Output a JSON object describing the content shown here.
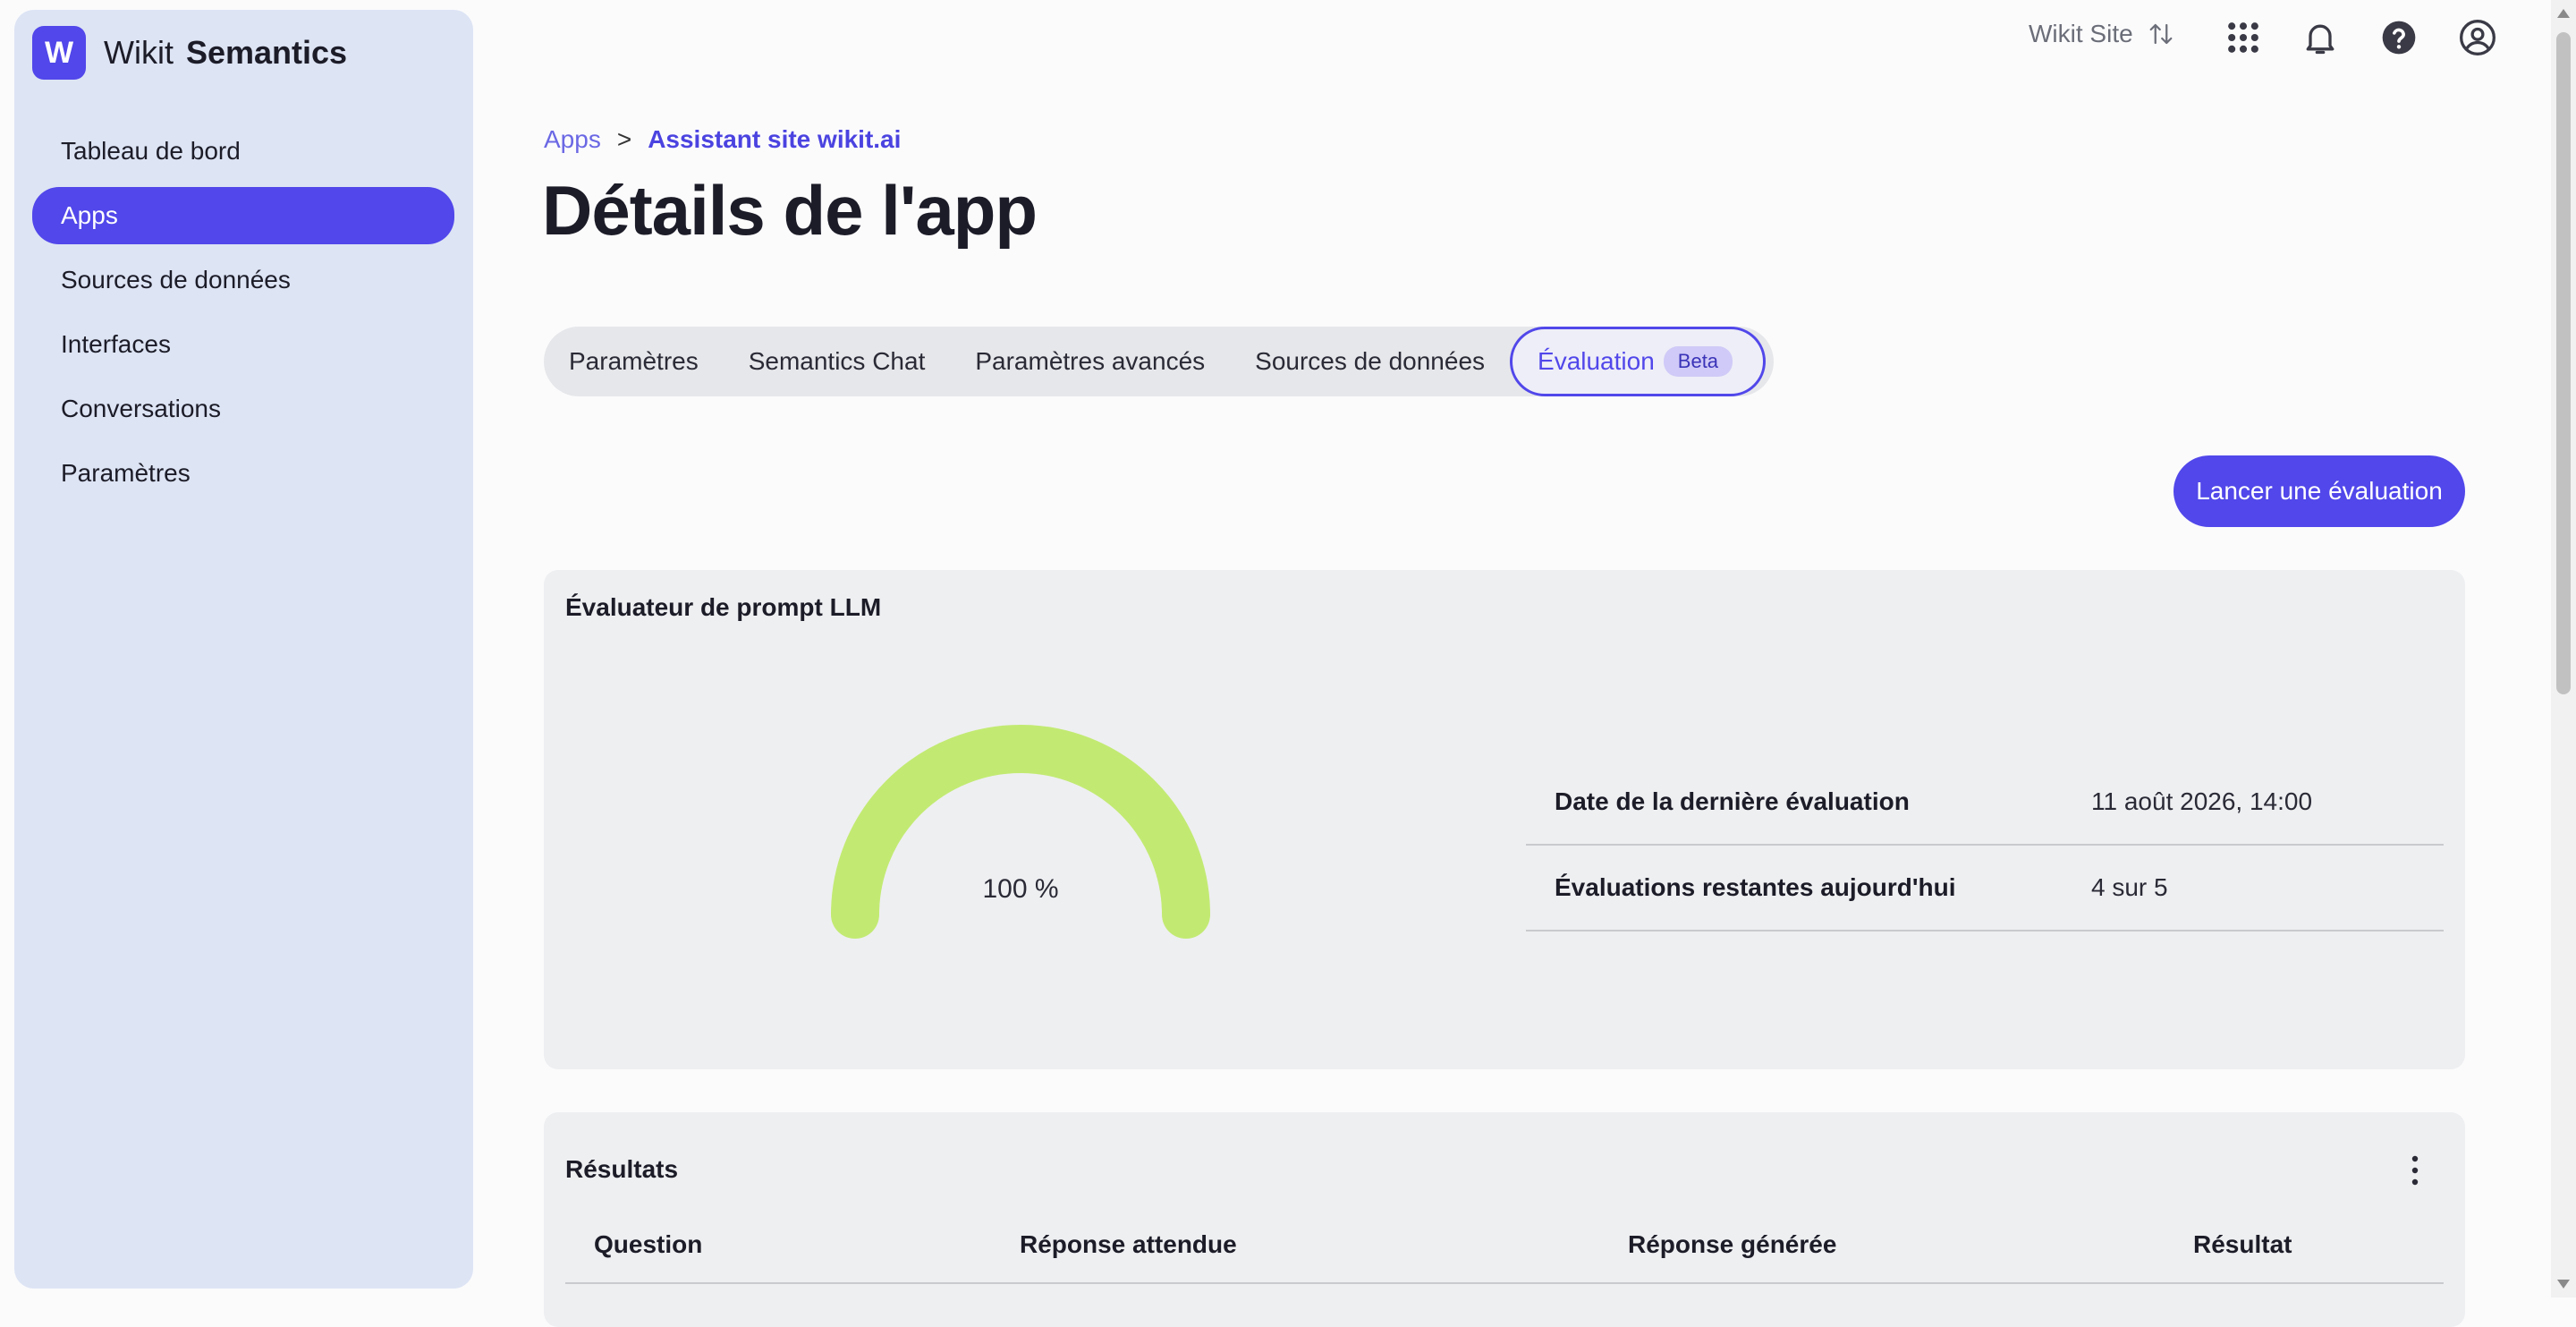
{
  "sidebar": {
    "logo_letter": "W",
    "brand_name": "Wikit",
    "brand_product": "Semantics",
    "items": [
      {
        "label": "Tableau de bord",
        "active": false
      },
      {
        "label": "Apps",
        "active": true
      },
      {
        "label": "Sources de données",
        "active": false
      },
      {
        "label": "Interfaces",
        "active": false
      },
      {
        "label": "Conversations",
        "active": false
      },
      {
        "label": "Paramètres",
        "active": false
      }
    ]
  },
  "topbar": {
    "site_label": "Wikit Site",
    "icons": [
      "swap-vertical-icon",
      "apps-grid-icon",
      "bell-icon",
      "help-icon",
      "user-icon"
    ]
  },
  "breadcrumb": {
    "parent": "Apps",
    "separator": ">",
    "current": "Assistant site wikit.ai"
  },
  "page": {
    "title": "Détails de l'app"
  },
  "tabs": {
    "items": [
      "Paramètres",
      "Semantics Chat",
      "Paramètres avancés",
      "Sources de données"
    ],
    "active": "Évaluation",
    "active_badge": "Beta"
  },
  "actions": {
    "launch_label": "Lancer une évaluation"
  },
  "evaluator": {
    "title": "Évaluateur de prompt LLM",
    "score": 1.0,
    "score_label": "100 %",
    "rows": [
      {
        "key": "Date de la dernière évaluation",
        "value": "11 août 2026, 14:00"
      },
      {
        "key": "Évaluations restantes aujourd'hui",
        "value": "4 sur 5"
      }
    ]
  },
  "results": {
    "title": "Résultats",
    "columns": [
      "Question",
      "Réponse attendue",
      "Réponse générée",
      "Résultat"
    ]
  },
  "colors": {
    "accent": "#5147ea",
    "sidebar_bg": "#dde4f4",
    "gauge": "#c2ea72",
    "card_bg": "#eeeff1"
  }
}
